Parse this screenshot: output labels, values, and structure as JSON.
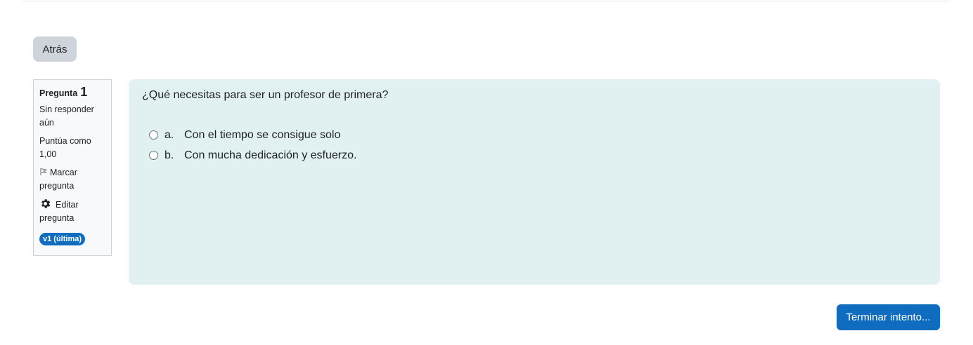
{
  "nav": {
    "back_label": "Atrás"
  },
  "question_info": {
    "label": "Pregunta",
    "number": "1",
    "status": "Sin responder aún",
    "grade": "Puntúa como 1,00",
    "flag_label": "Marcar pregunta",
    "edit_label": "Editar pregunta",
    "version_badge": "v1 (última)",
    "icons": {
      "flag": "flag-icon",
      "edit": "gear-icon"
    }
  },
  "question": {
    "text": "¿Qué necesitas para ser un profesor de primera?",
    "options": [
      {
        "letter": "a.",
        "text": "Con el tiempo se consigue solo",
        "selected": false
      },
      {
        "letter": "b.",
        "text": "Con mucha dedicación y esfuerzo.",
        "selected": false
      }
    ]
  },
  "footer": {
    "finish_label": "Terminar intento..."
  },
  "colors": {
    "primary": "#0f6cbf",
    "question_bg": "#e1f0f1",
    "info_bg": "#f8f9fa",
    "secondary_button": "#ced4da"
  }
}
